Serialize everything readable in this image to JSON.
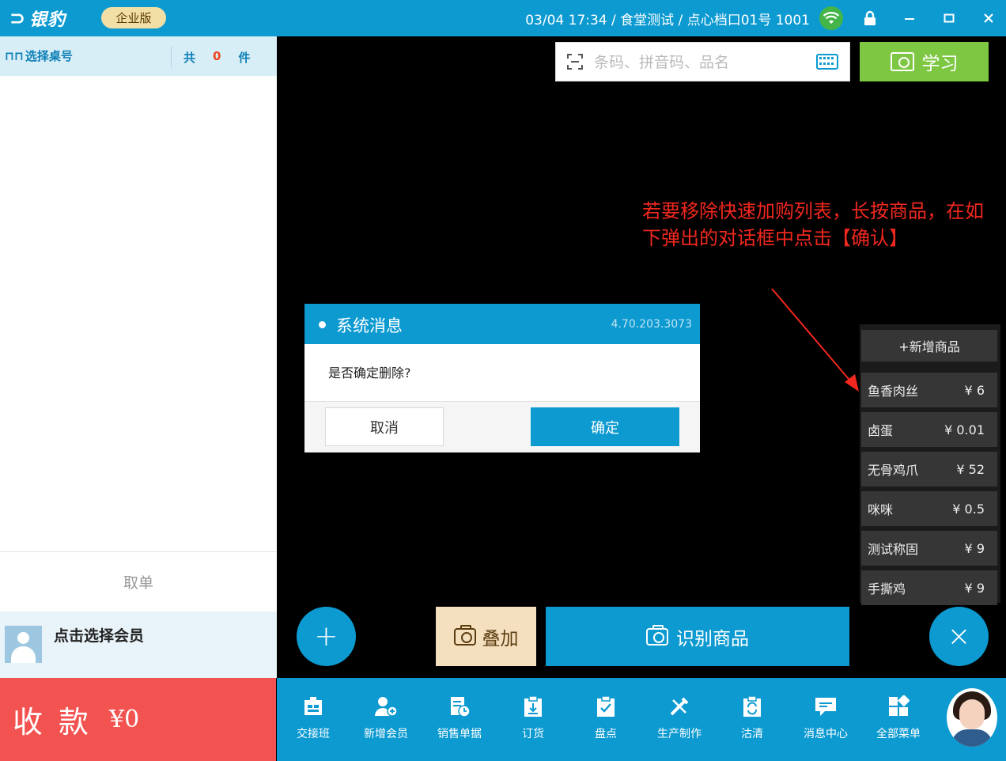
{
  "titlebar": {
    "logo_text": "银豹",
    "edition": "企业版",
    "info": "03/04 17:34 / 食堂测试 / 点心档口01号 1001"
  },
  "left": {
    "table_select": "选择桌号",
    "total_prefix": "共",
    "total_count": "0",
    "total_unit": "件",
    "retrieve_order": "取单",
    "member_label": "点击选择会员",
    "pay_label": "收款",
    "pay_amount": "¥0"
  },
  "search": {
    "placeholder": "条码、拼音码、品名"
  },
  "learn_label": "学习",
  "instruction": "若要移除快速加购列表，长按商品，在如下弹出的对话框中点击【确认】",
  "dialog": {
    "title": "系统消息",
    "version": "4.70.203.3073",
    "message": "是否确定删除?",
    "cancel": "取消",
    "confirm": "确定"
  },
  "quick_panel": {
    "add_label": "+新增商品",
    "items": [
      {
        "name": "鱼香肉丝",
        "price": "¥ 6"
      },
      {
        "name": "卤蛋",
        "price": "¥ 0.01"
      },
      {
        "name": "无骨鸡爪",
        "price": "¥ 52"
      },
      {
        "name": "咪咪",
        "price": "¥ 0.5"
      },
      {
        "name": "测试称固",
        "price": "¥ 9"
      },
      {
        "name": "手撕鸡",
        "price": "¥ 9"
      }
    ]
  },
  "actions": {
    "stack": "叠加",
    "recognize": "识别商品",
    "plus": "+",
    "close": "×"
  },
  "toolbar": [
    {
      "label": "交接班",
      "icon": "shift-handover-icon"
    },
    {
      "label": "新增会员",
      "icon": "add-member-icon"
    },
    {
      "label": "销售单据",
      "icon": "sales-receipt-icon"
    },
    {
      "label": "订货",
      "icon": "order-goods-icon"
    },
    {
      "label": "盘点",
      "icon": "inventory-check-icon"
    },
    {
      "label": "生产制作",
      "icon": "production-icon"
    },
    {
      "label": "沽清",
      "icon": "sold-out-icon"
    },
    {
      "label": "消息中心",
      "icon": "message-center-icon"
    },
    {
      "label": "全部菜单",
      "icon": "all-menu-icon"
    }
  ],
  "colors": {
    "primary": "#0c9ad1",
    "pay": "#f35350",
    "learn": "#7dc742",
    "instruction": "#f1281f"
  }
}
